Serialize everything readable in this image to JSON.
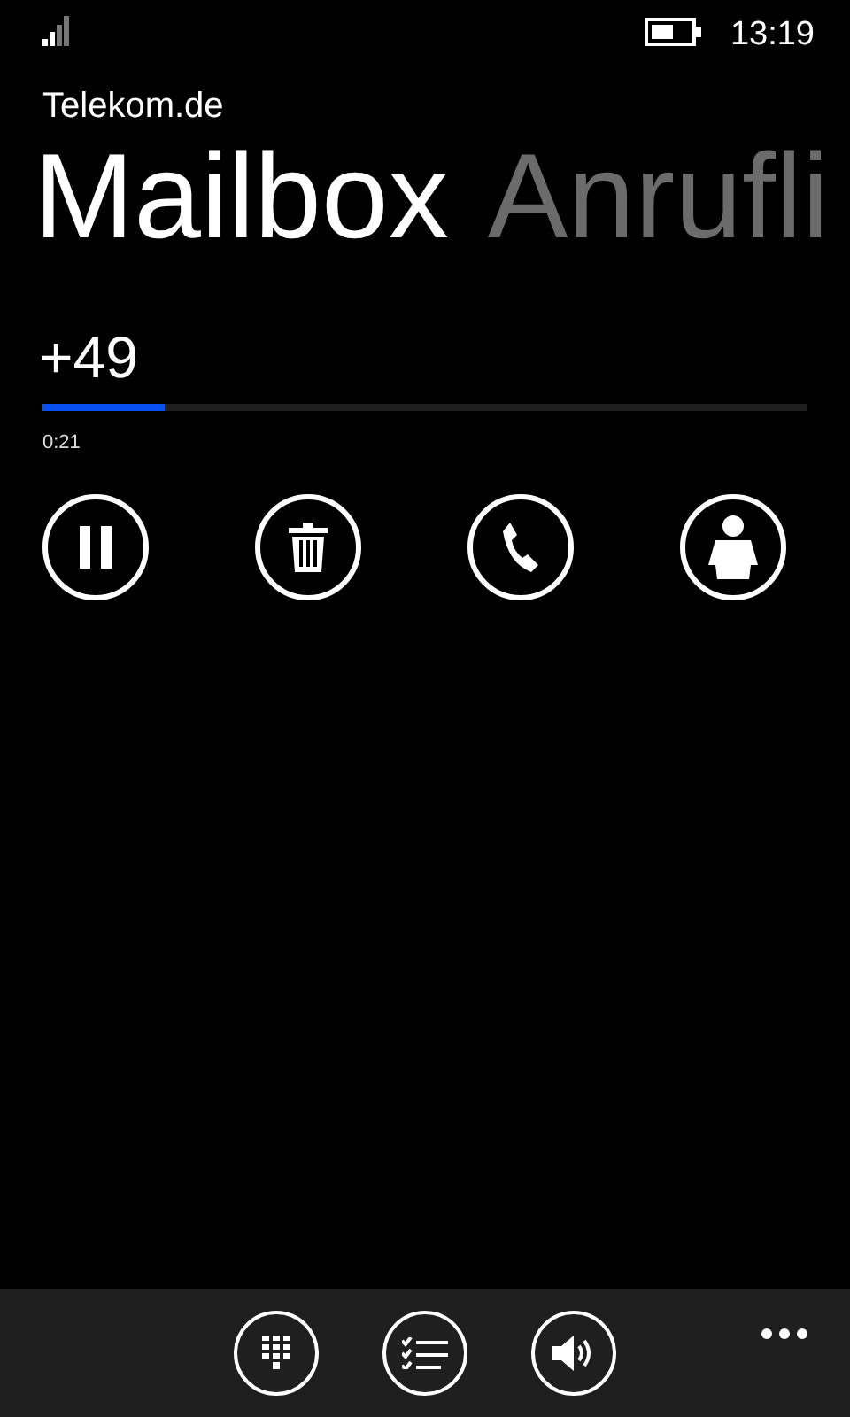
{
  "status_bar": {
    "time": "13:19"
  },
  "app_title": "Telekom.de",
  "pivots": [
    {
      "label": "Mailbox",
      "selected": true
    },
    {
      "label": "Anrufli",
      "selected": false
    }
  ],
  "message": {
    "caller": "+49",
    "progress": {
      "level": 0.16
    },
    "elapsed": "0:21"
  }
}
